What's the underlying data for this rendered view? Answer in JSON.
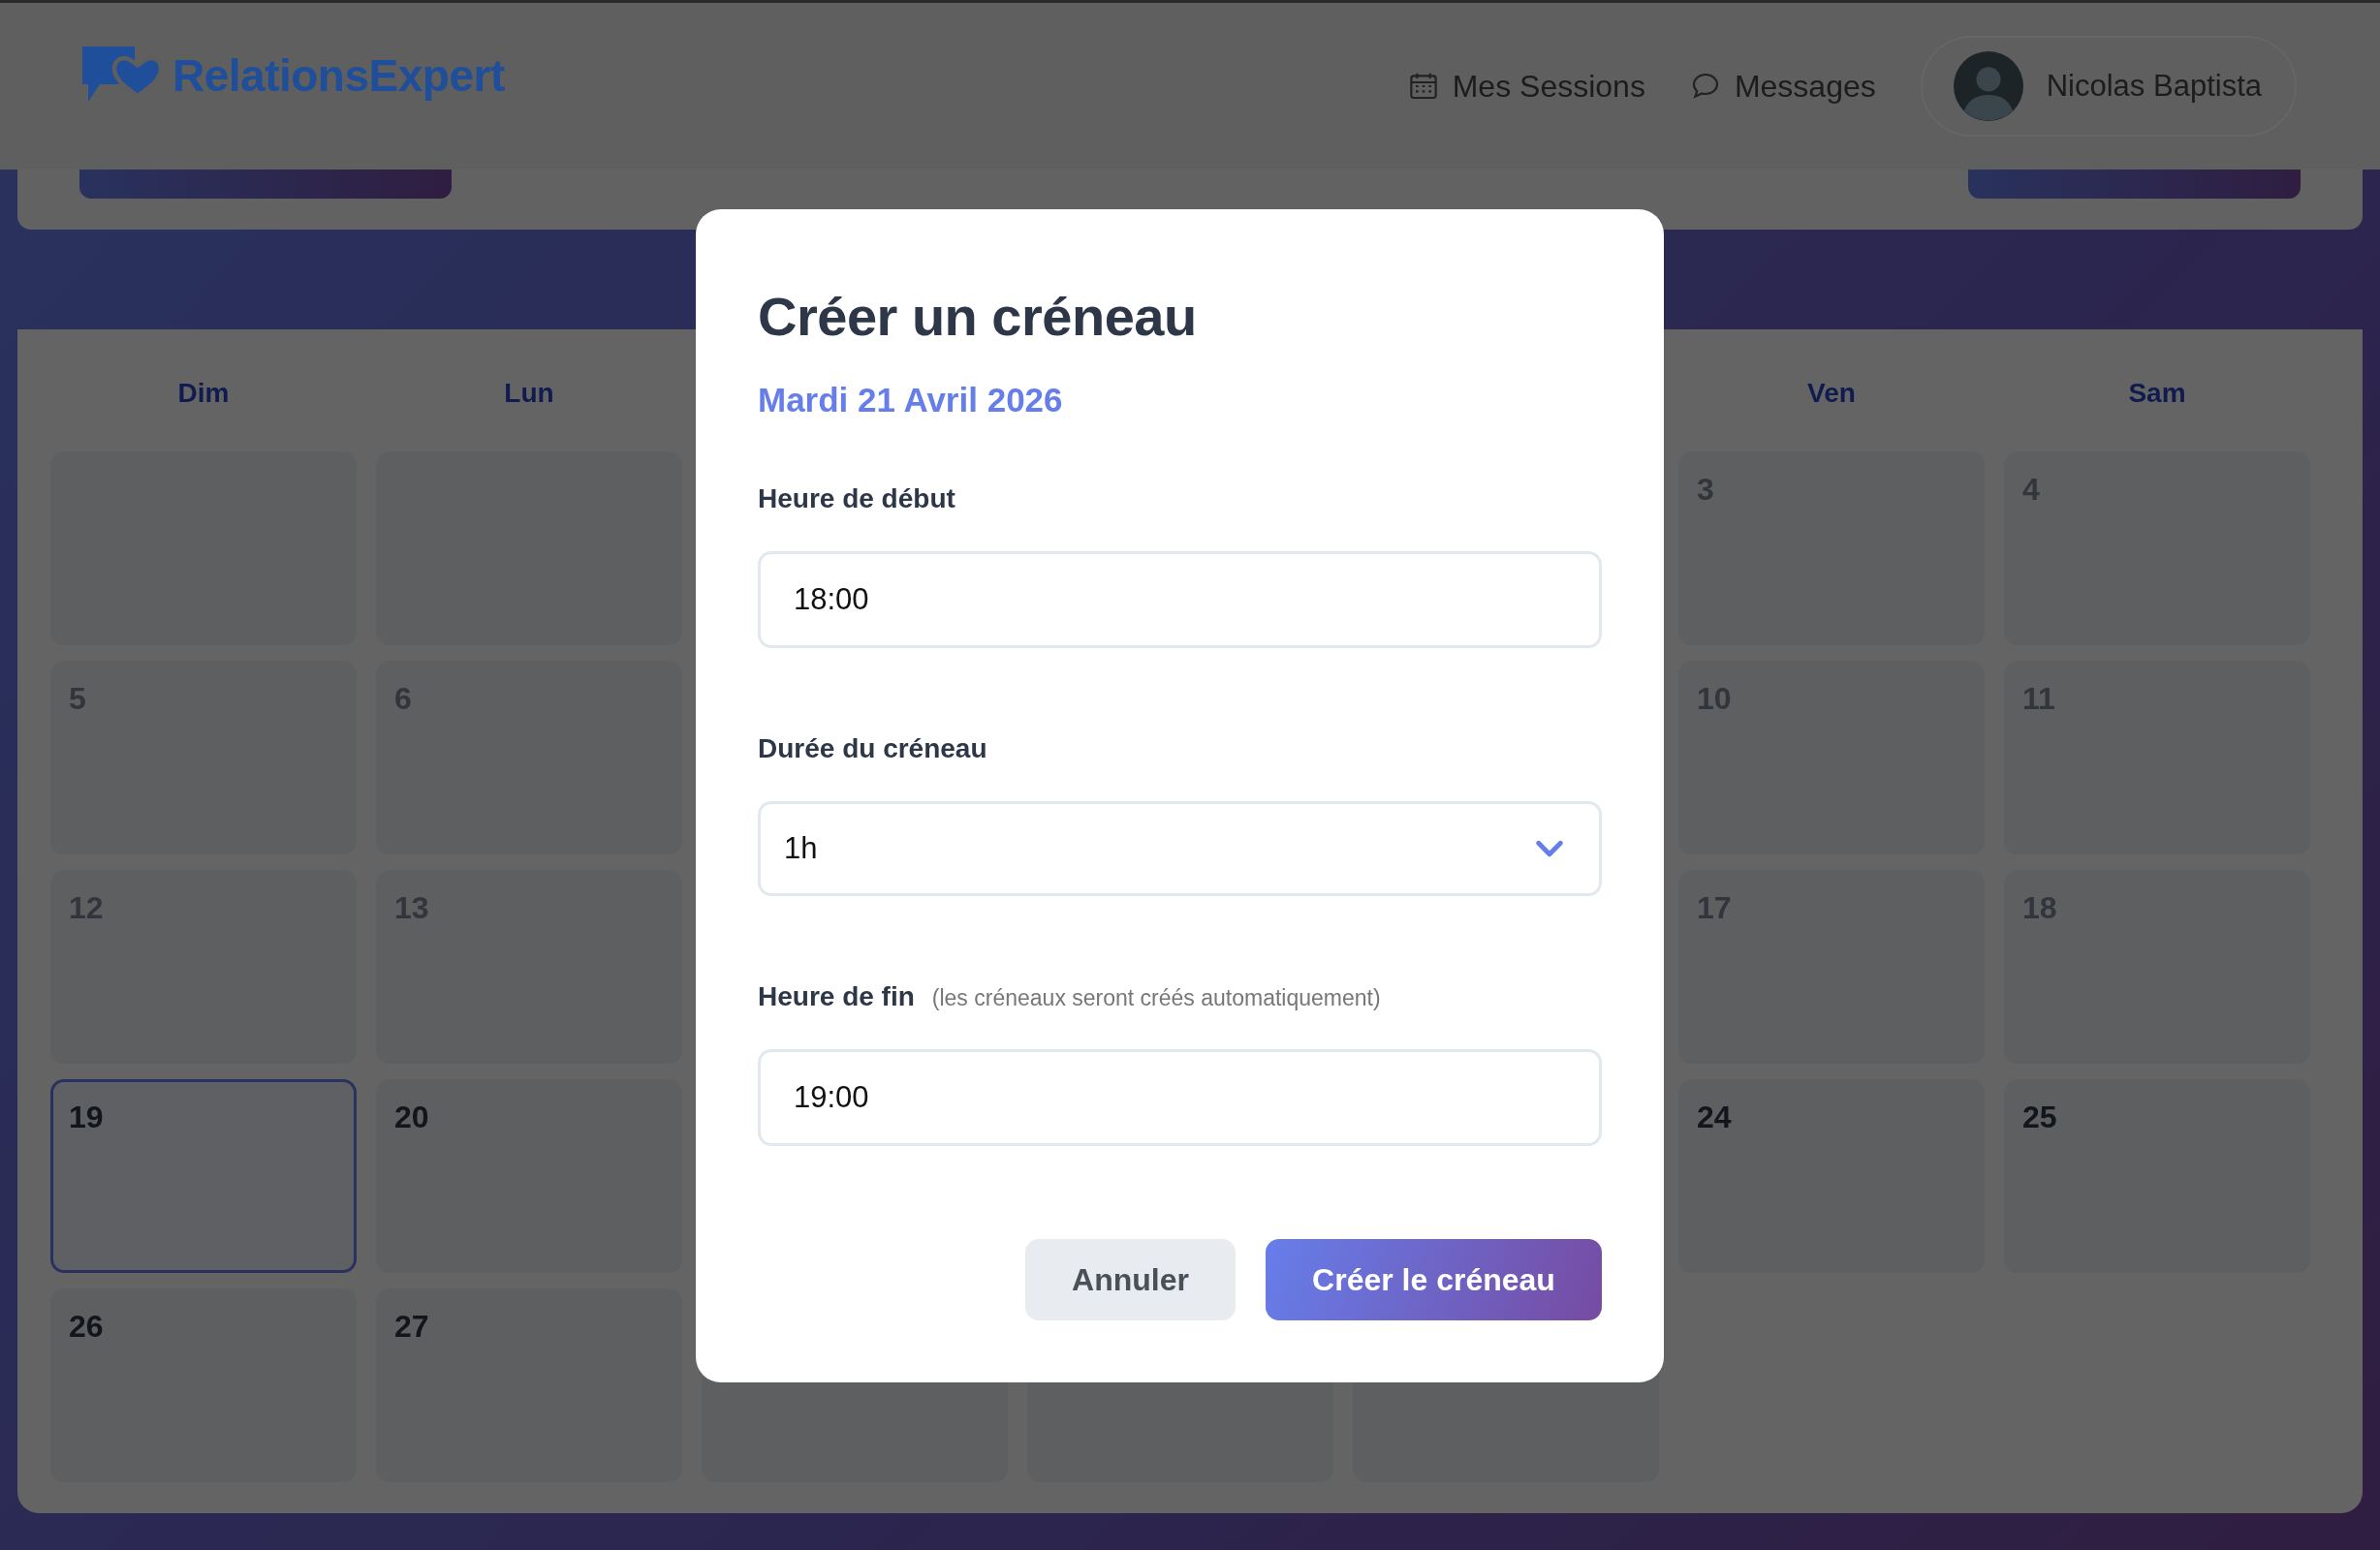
{
  "header": {
    "brand": "RelationsExpert",
    "nav": [
      {
        "kind": "calendar",
        "label": "Mes Sessions"
      },
      {
        "kind": "chat",
        "label": "Messages"
      }
    ],
    "user": {
      "name": "Nicolas Baptista"
    }
  },
  "calendar": {
    "weekdays": [
      {
        "kind": "day",
        "label": "Dim"
      },
      {
        "kind": "day",
        "label": "Lun"
      },
      {
        "kind": "covered"
      },
      {
        "kind": "covered"
      },
      {
        "kind": "covered"
      },
      {
        "kind": "day",
        "label": "Ven"
      },
      {
        "kind": "day",
        "label": "Sam"
      }
    ],
    "weeks": [
      [
        {
          "kind": "blank"
        },
        {
          "kind": "blank"
        },
        {
          "kind": "covered"
        },
        {
          "kind": "covered"
        },
        {
          "kind": "covered"
        },
        {
          "kind": "day",
          "day": "3",
          "past": true,
          "today": false
        },
        {
          "kind": "day",
          "day": "4",
          "past": true,
          "today": false
        }
      ],
      [
        {
          "kind": "day",
          "day": "5",
          "past": true,
          "today": false
        },
        {
          "kind": "day",
          "day": "6",
          "past": true,
          "today": false
        },
        {
          "kind": "covered"
        },
        {
          "kind": "covered"
        },
        {
          "kind": "covered"
        },
        {
          "kind": "day",
          "day": "10",
          "past": true,
          "today": false
        },
        {
          "kind": "day",
          "day": "11",
          "past": true,
          "today": false
        }
      ],
      [
        {
          "kind": "day",
          "day": "12",
          "past": true,
          "today": false
        },
        {
          "kind": "day",
          "day": "13",
          "past": true,
          "today": false
        },
        {
          "kind": "covered"
        },
        {
          "kind": "covered"
        },
        {
          "kind": "covered"
        },
        {
          "kind": "day",
          "day": "17",
          "past": true,
          "today": false
        },
        {
          "kind": "day",
          "day": "18",
          "past": true,
          "today": false
        }
      ],
      [
        {
          "kind": "day",
          "day": "19",
          "past": false,
          "today": true
        },
        {
          "kind": "day",
          "day": "20",
          "past": false,
          "today": false
        },
        {
          "kind": "covered"
        },
        {
          "kind": "covered"
        },
        {
          "kind": "covered"
        },
        {
          "kind": "day",
          "day": "24",
          "past": false,
          "today": false
        },
        {
          "kind": "day",
          "day": "25",
          "past": false,
          "today": false
        }
      ],
      [
        {
          "kind": "day",
          "day": "26",
          "past": false,
          "today": false
        },
        {
          "kind": "day",
          "day": "27",
          "past": false,
          "today": false
        },
        {
          "kind": "covered"
        },
        {
          "kind": "covered"
        },
        {
          "kind": "covered"
        },
        {
          "kind": "none"
        },
        {
          "kind": "none"
        }
      ]
    ]
  },
  "modal": {
    "title": "Créer un créneau",
    "date": "Mardi 21 Avril 2026",
    "fields": [
      {
        "kind": "time",
        "label": "Heure de début",
        "value": "18:00"
      },
      {
        "kind": "select",
        "label": "Durée du créneau",
        "value": "1h"
      },
      {
        "kind": "time",
        "label": "Heure de fin",
        "hint": "(les créneaux seront créés automatiquement)",
        "value": "19:00"
      }
    ],
    "buttons": [
      {
        "kind": "secondary",
        "label": "Annuler"
      },
      {
        "kind": "primary",
        "label": "Créer le créneau"
      }
    ]
  }
}
